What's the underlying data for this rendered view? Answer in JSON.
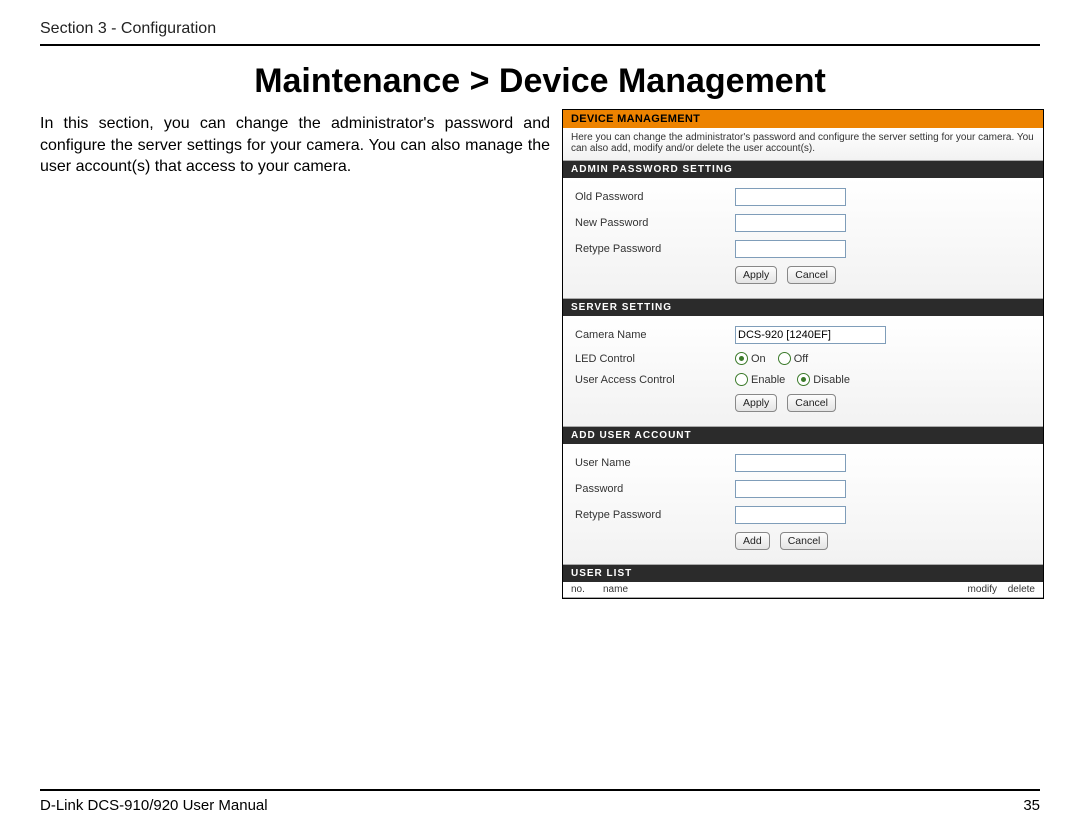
{
  "section_header": "Section 3 - Configuration",
  "page_title": "Maintenance > Device Management",
  "intro_text": "In this section, you can change the administrator's password and configure the server settings for your camera. You can also manage the user account(s) that access to your camera.",
  "panel": {
    "header": "Device Management",
    "note": "Here you can change the administrator's password and configure the server setting for your camera. You can also add, modify and/or delete the user account(s).",
    "admin": {
      "title": "Admin Password Setting",
      "old_pw_label": "Old Password",
      "new_pw_label": "New Password",
      "retype_pw_label": "Retype Password",
      "apply": "Apply",
      "cancel": "Cancel"
    },
    "server": {
      "title": "Server Setting",
      "camera_name_label": "Camera Name",
      "camera_name_value": "DCS-920 [1240EF]",
      "led_label": "LED Control",
      "led_on": "On",
      "led_off": "Off",
      "uac_label": "User Access Control",
      "uac_enable": "Enable",
      "uac_disable": "Disable",
      "apply": "Apply",
      "cancel": "Cancel"
    },
    "add_user": {
      "title": "Add User Account",
      "user_name_label": "User Name",
      "password_label": "Password",
      "retype_label": "Retype Password",
      "add": "Add",
      "cancel": "Cancel"
    },
    "user_list": {
      "title": "User List",
      "col_no": "no.",
      "col_name": "name",
      "col_modify": "modify",
      "col_delete": "delete"
    }
  },
  "footer": {
    "manual": "D-Link DCS-910/920 User Manual",
    "page_no": "35"
  }
}
